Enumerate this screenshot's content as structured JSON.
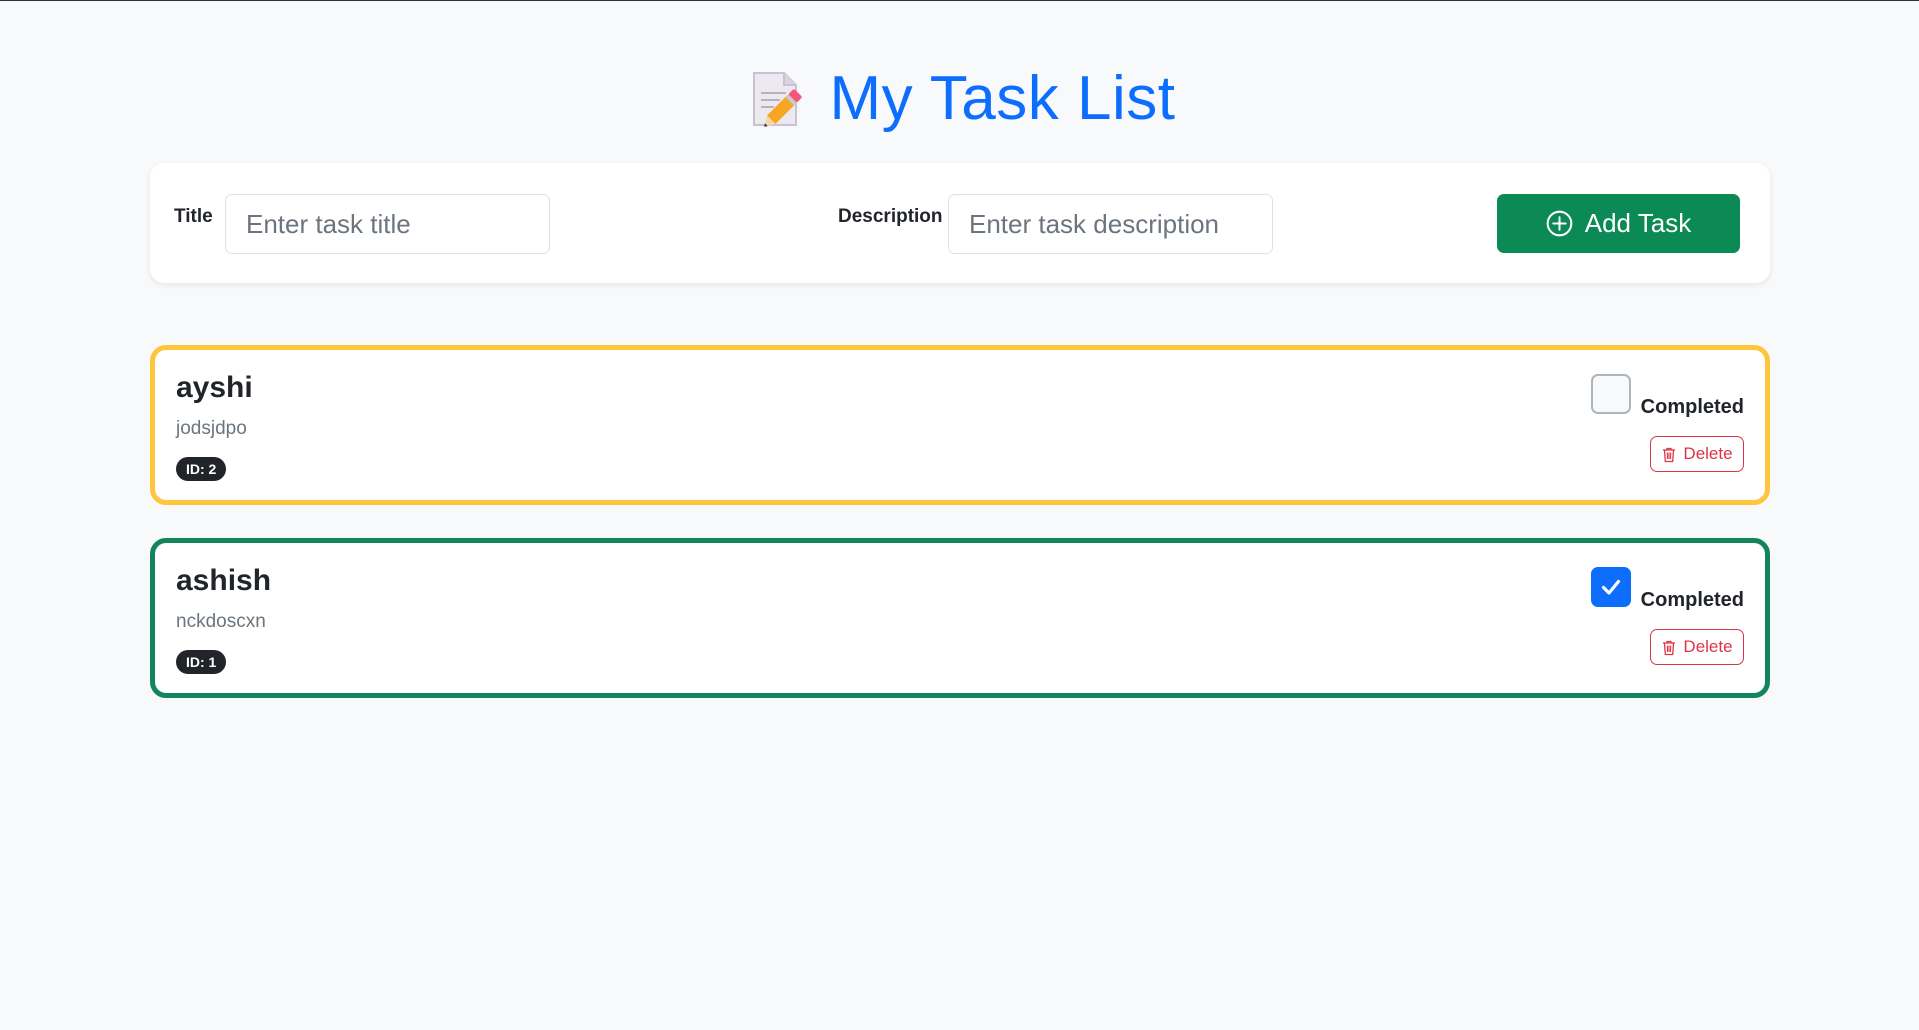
{
  "header": {
    "icon": "memo-icon",
    "title": "My Task List"
  },
  "form": {
    "title_label": "Title",
    "title_placeholder": "Enter task title",
    "title_value": "",
    "description_label": "Description",
    "description_placeholder": "Enter task description",
    "description_value": "",
    "add_button_label": "Add Task",
    "add_button_icon": "plus-circle-icon"
  },
  "tasks": [
    {
      "title": "ayshi",
      "description": "jodsjdpo",
      "id_badge": "ID: 2",
      "completed": false,
      "completed_label": "Completed",
      "delete_label": "Delete",
      "border_color": "#ffc53d"
    },
    {
      "title": "ashish",
      "description": "nckdoscxn",
      "id_badge": "ID: 1",
      "completed": true,
      "completed_label": "Completed",
      "delete_label": "Delete",
      "border_color": "#12855a"
    }
  ],
  "colors": {
    "title_blue": "#0d6efd",
    "success_green": "#0b8a55",
    "danger_red": "#dc3545",
    "pending_yellow": "#ffc53d",
    "background": "#f8f9fa"
  }
}
